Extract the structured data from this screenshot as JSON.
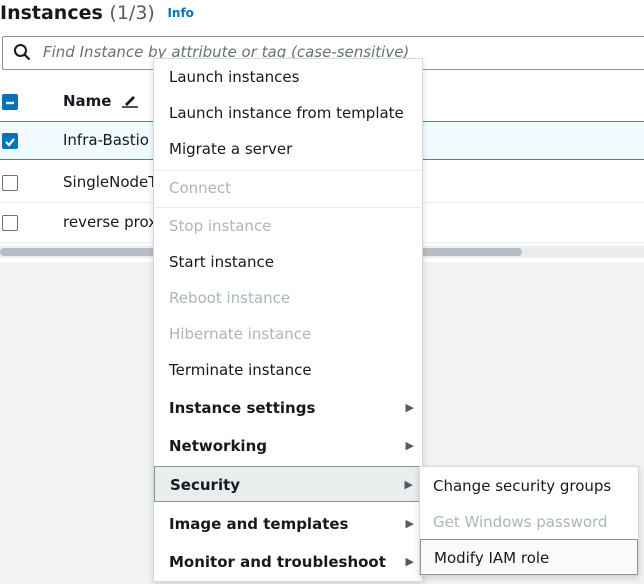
{
  "header": {
    "title": "Instances",
    "count": "(1/3)",
    "info": "Info"
  },
  "search": {
    "placeholder": "Find Instance by attribute or tag (case-sensitive)"
  },
  "table": {
    "col_name": "Name",
    "rows": [
      {
        "name": "Infra-Bastio",
        "selected": true
      },
      {
        "name": "SingleNodeT",
        "selected": false
      },
      {
        "name": "reverse prox",
        "selected": false
      }
    ]
  },
  "menu": {
    "items": [
      {
        "label": "Launch instances",
        "disabled": false
      },
      {
        "label": "Launch instance from template",
        "disabled": false
      },
      {
        "label": "Migrate a server",
        "disabled": false
      },
      {
        "label": "Connect",
        "disabled": true
      },
      {
        "label": "Stop instance",
        "disabled": true
      },
      {
        "label": "Start instance",
        "disabled": false
      },
      {
        "label": "Reboot instance",
        "disabled": true
      },
      {
        "label": "Hibernate instance",
        "disabled": true
      },
      {
        "label": "Terminate instance",
        "disabled": false
      },
      {
        "label": "Instance settings",
        "submenu": true
      },
      {
        "label": "Networking",
        "submenu": true
      },
      {
        "label": "Security",
        "submenu": true,
        "active": true
      },
      {
        "label": "Image and templates",
        "submenu": true
      },
      {
        "label": "Monitor and troubleshoot",
        "submenu": true
      }
    ]
  },
  "submenu": {
    "items": [
      {
        "label": "Change security groups",
        "disabled": false
      },
      {
        "label": "Get Windows password",
        "disabled": true
      },
      {
        "label": "Modify IAM role",
        "disabled": false,
        "active": true
      }
    ]
  },
  "colors": {
    "accent": "#0073bb",
    "disabled": "#aab7b8",
    "selected_row": "#f1faff"
  }
}
